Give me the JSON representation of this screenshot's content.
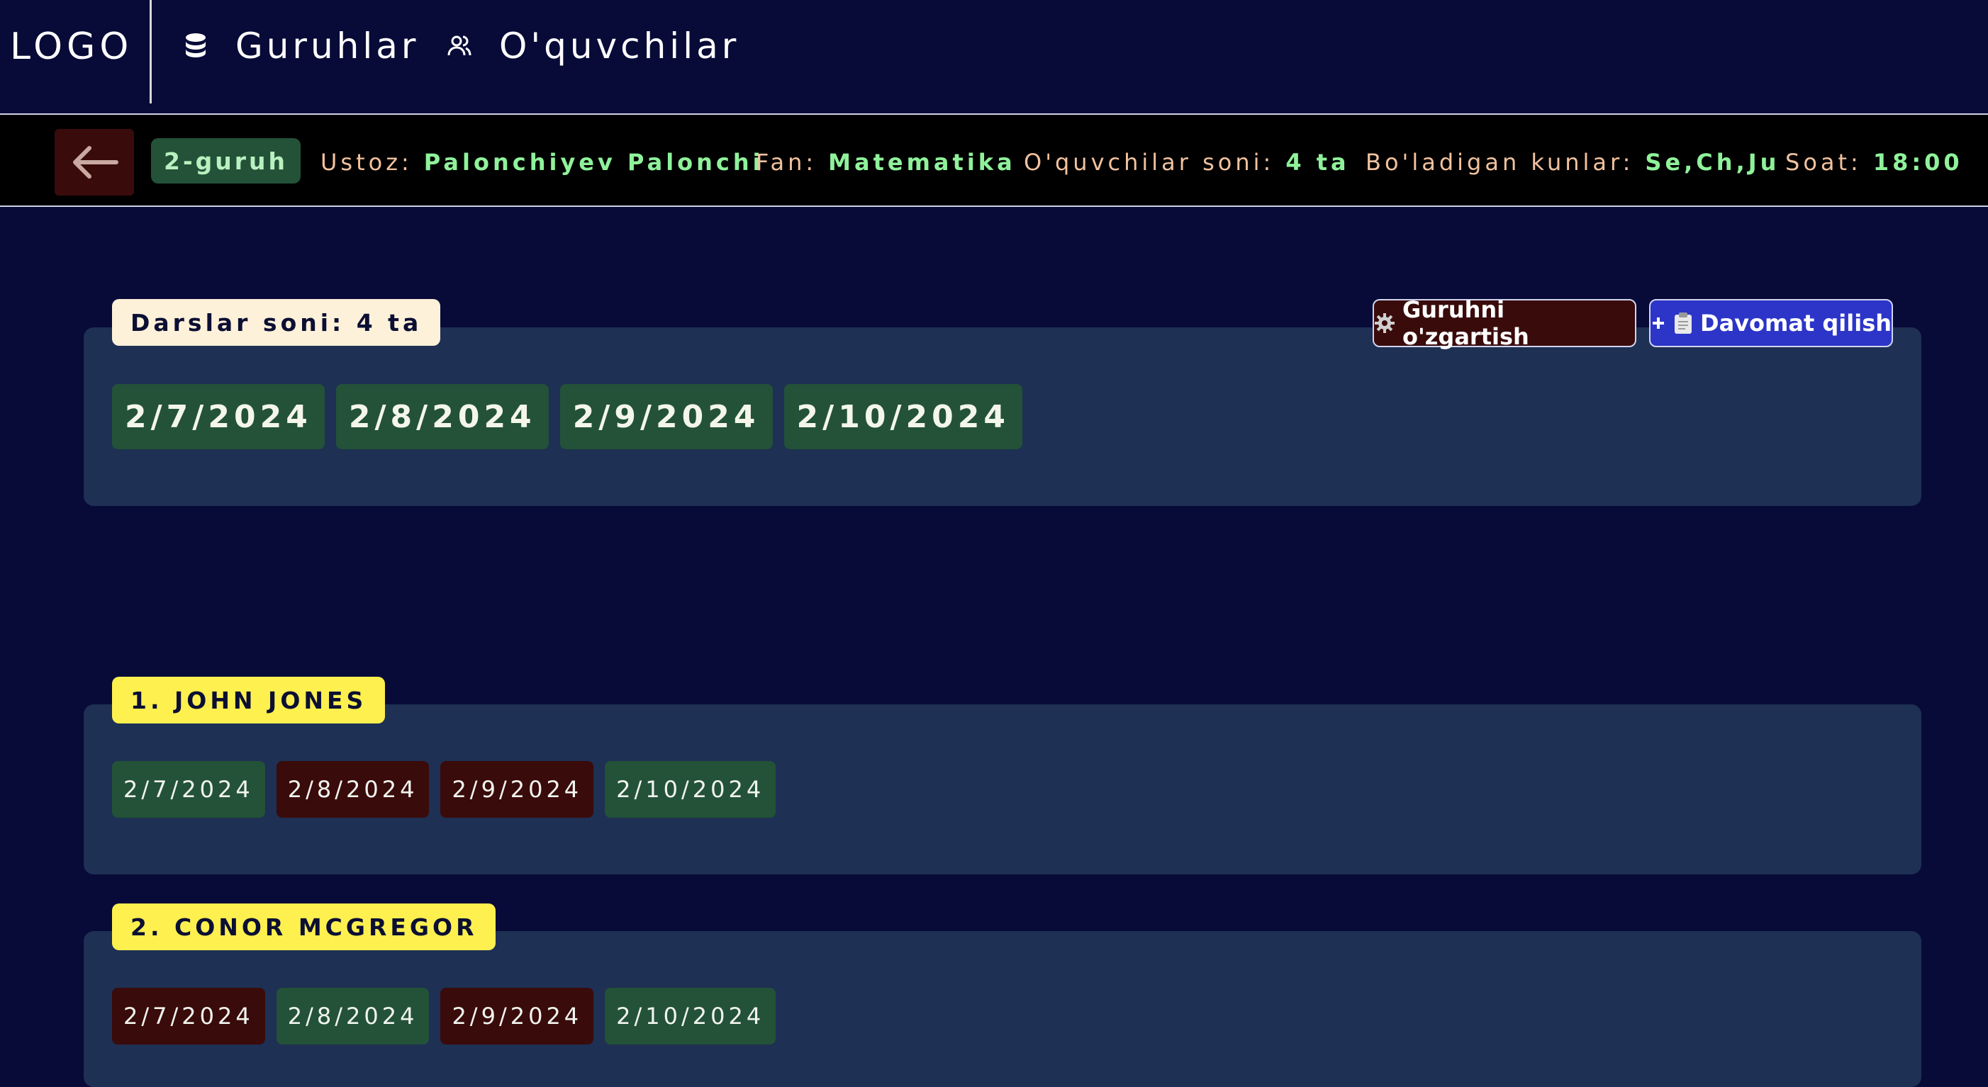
{
  "nav": {
    "logo": "LOGO",
    "groups_label": "Guruhlar",
    "students_label": "O'quvchilar",
    "groups_icon": "database-icon",
    "students_icon": "users-icon"
  },
  "infobar": {
    "group_badge": "2-guruh",
    "teacher_label": "Ustoz:",
    "teacher_value": "Palonchiyev Palonchi",
    "subject_label": "Fan:",
    "subject_value": "Matematika",
    "count_label": "O'quvchilar soni:",
    "count_value": "4 ta",
    "days_label": "Bo'ladigan kunlar:",
    "days_value": "Se,Ch,Ju",
    "time_label": "Soat:",
    "time_value": "18:00"
  },
  "lessons": {
    "count_label": "Darslar soni: 4 ta",
    "edit_button": "Guruhni o'zgartish",
    "attend_button": "Davomat qilish",
    "dates": [
      "2/7/2024",
      "2/8/2024",
      "2/9/2024",
      "2/10/2024"
    ]
  },
  "students": [
    {
      "name": "1. JOHN JONES",
      "attendance": [
        {
          "date": "2/7/2024",
          "status": "present"
        },
        {
          "date": "2/8/2024",
          "status": "absent"
        },
        {
          "date": "2/9/2024",
          "status": "absent"
        },
        {
          "date": "2/10/2024",
          "status": "present"
        }
      ]
    },
    {
      "name": "2. CONOR MCGREGOR",
      "attendance": [
        {
          "date": "2/7/2024",
          "status": "absent"
        },
        {
          "date": "2/8/2024",
          "status": "present"
        },
        {
          "date": "2/9/2024",
          "status": "absent"
        },
        {
          "date": "2/10/2024",
          "status": "present"
        }
      ]
    }
  ],
  "colors": {
    "background": "#080b37",
    "panel": "#1e3053",
    "present": "#235238",
    "absent": "#3a0b0b",
    "accent_blue": "#2c35c8",
    "highlight_yellow": "#fdf04f",
    "value_green": "#8ff29b",
    "label_peach": "#f2c29f"
  }
}
